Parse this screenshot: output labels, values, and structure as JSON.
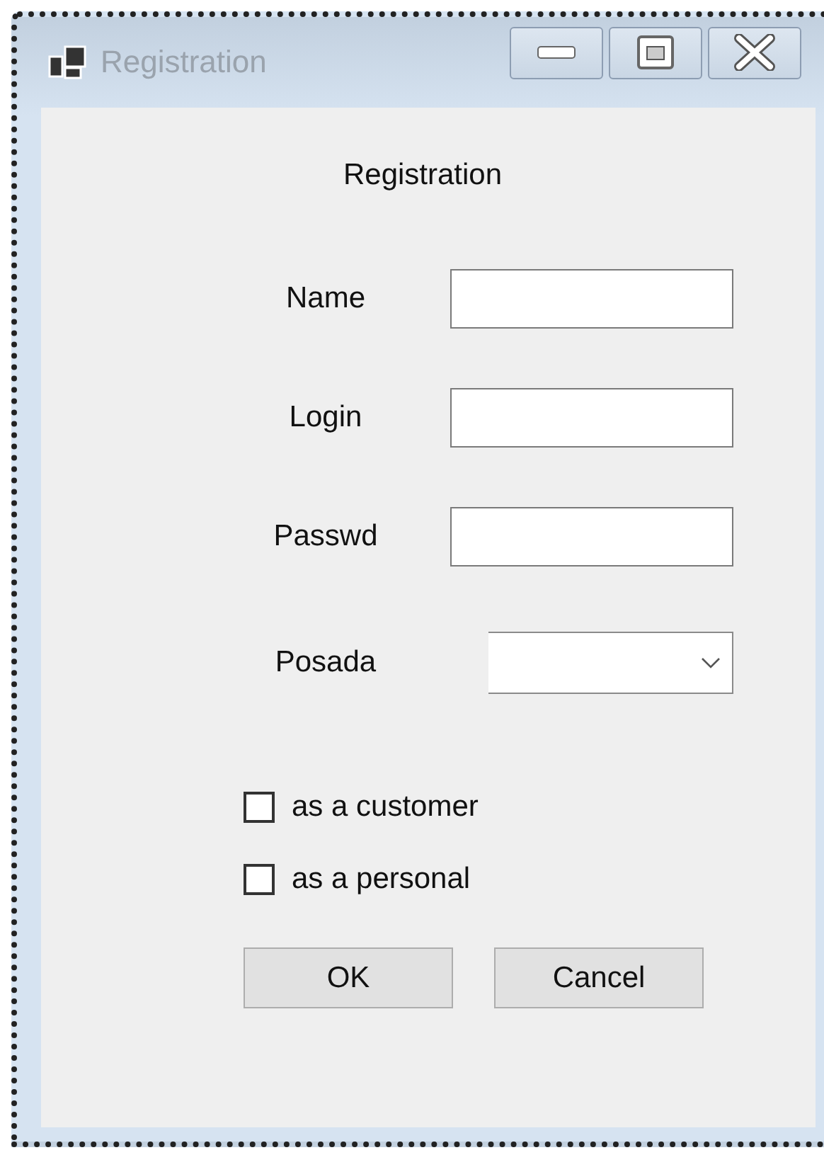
{
  "window": {
    "title": "Registration"
  },
  "form": {
    "heading": "Registration",
    "fields": [
      {
        "kind": "text",
        "label": "Name"
      },
      {
        "kind": "text",
        "label": "Login"
      },
      {
        "kind": "text",
        "label": "Passwd"
      },
      {
        "kind": "combo",
        "label": "Posada"
      }
    ],
    "checkboxes": [
      {
        "label": "as a customer",
        "checked": false
      },
      {
        "label": "as a personal",
        "checked": false
      }
    ],
    "buttons": [
      "OK",
      "Cancel"
    ]
  }
}
